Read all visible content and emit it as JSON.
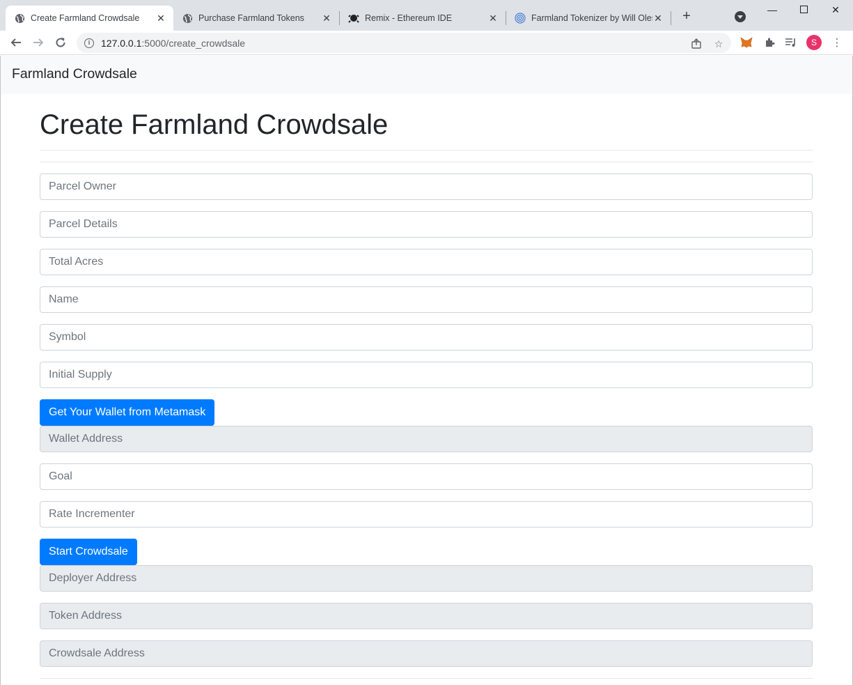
{
  "browser": {
    "tabs": [
      {
        "title": "Create Farmland Crowdsale",
        "icon": "globe-icon"
      },
      {
        "title": "Purchase Farmland Tokens",
        "icon": "globe-icon"
      },
      {
        "title": "Remix - Ethereum IDE",
        "icon": "remix-icon"
      },
      {
        "title": "Farmland Tokenizer by Will Olesi",
        "icon": "fingerprint-icon"
      }
    ],
    "url_host": "127.0.0.1",
    "url_path": ":5000/create_crowdsale",
    "profile_initial": "S"
  },
  "navbar": {
    "brand": "Farmland Crowdsale"
  },
  "page": {
    "title": "Create Farmland Crowdsale",
    "fields": {
      "parcel_owner": "Parcel Owner",
      "parcel_details": "Parcel Details",
      "total_acres": "Total Acres",
      "name": "Name",
      "symbol": "Symbol",
      "initial_supply": "Initial Supply",
      "wallet_address": "Wallet Address",
      "goal": "Goal",
      "rate_incrementer": "Rate Incrementer",
      "deployer_address": "Deployer Address",
      "token_address": "Token Address",
      "crowdsale_address": "Crowdsale Address"
    },
    "buttons": {
      "get_wallet": "Get Your Wallet from Metamask",
      "start_crowdsale": "Start Crowdsale"
    }
  },
  "colors": {
    "primary": "#007bff",
    "navbar_bg": "#f8f9fa",
    "readonly_bg": "#e9ecef"
  }
}
